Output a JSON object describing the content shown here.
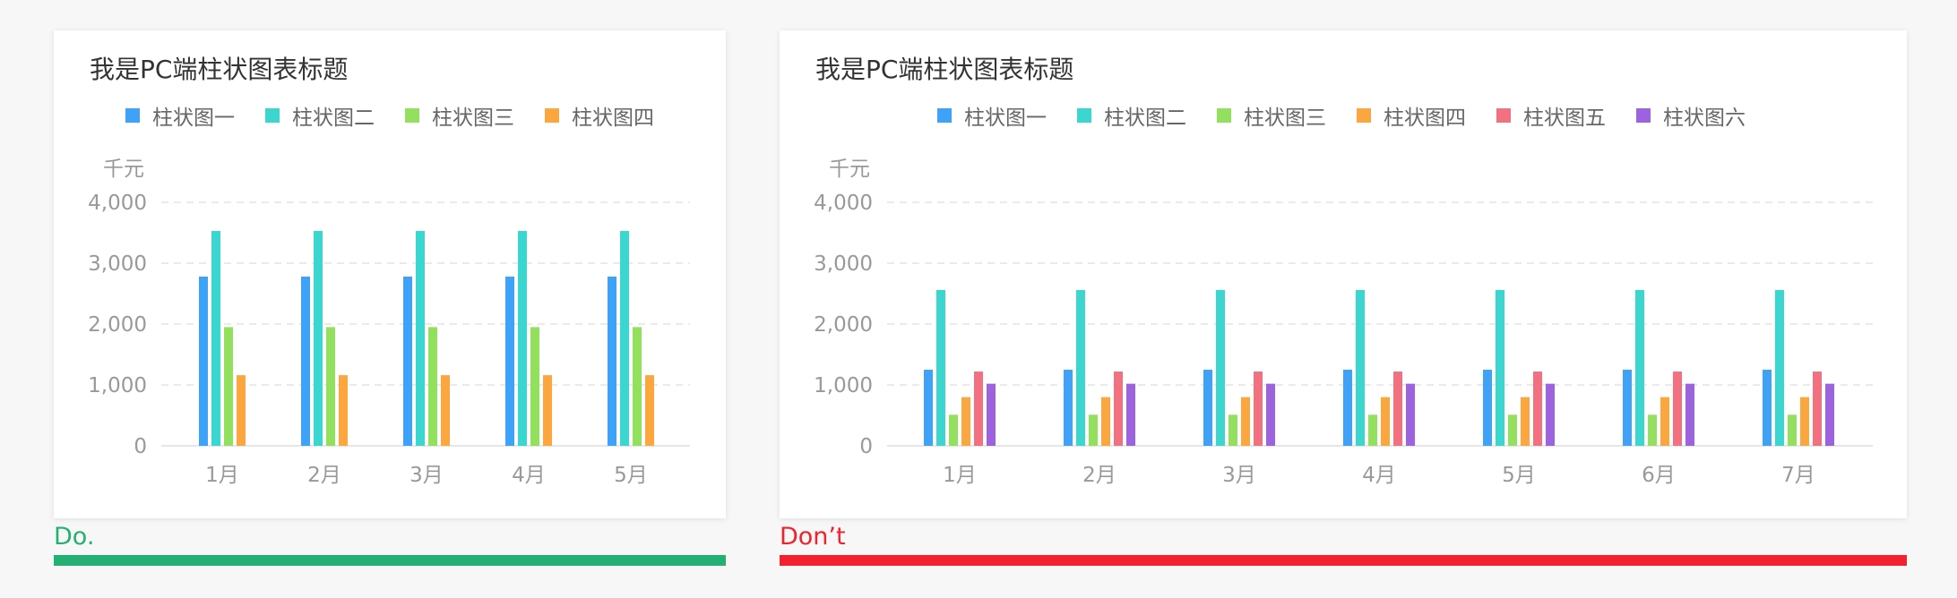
{
  "colors": [
    "#3ea2f8",
    "#3bd6cf",
    "#93e05e",
    "#fba63e",
    "#f2707f",
    "#9d62e0"
  ],
  "good_label": "Do.",
  "bad_label": "Don’t",
  "good_color": "#23b072",
  "bad_color": "#f3202d",
  "chart_data": [
    {
      "type": "bar",
      "title": "我是PC端柱状图表标题",
      "ylabel": "千元",
      "xlabel": "",
      "ylim": [
        0,
        4000
      ],
      "yticks": [
        "0",
        "1,000",
        "2,000",
        "3,000",
        "4,000"
      ],
      "grid": true,
      "legend_position": "top",
      "categories": [
        "1月",
        "2月",
        "3月",
        "4月",
        "5月"
      ],
      "series": [
        {
          "name": "柱状图一",
          "values": [
            2780,
            2780,
            2780,
            2780,
            2780
          ]
        },
        {
          "name": "柱状图二",
          "values": [
            3530,
            3530,
            3530,
            3530,
            3530
          ]
        },
        {
          "name": "柱状图三",
          "values": [
            1950,
            1950,
            1950,
            1950,
            1950
          ]
        },
        {
          "name": "柱状图四",
          "values": [
            1160,
            1160,
            1160,
            1160,
            1160
          ]
        }
      ]
    },
    {
      "type": "bar",
      "title": "我是PC端柱状图表标题",
      "ylabel": "千元",
      "xlabel": "",
      "ylim": [
        0,
        4000
      ],
      "yticks": [
        "0",
        "1,000",
        "2,000",
        "3,000",
        "4,000"
      ],
      "grid": true,
      "legend_position": "top",
      "categories": [
        "1月",
        "2月",
        "3月",
        "4月",
        "5月",
        "6月",
        "7月"
      ],
      "series": [
        {
          "name": "柱状图一",
          "values": [
            1250,
            1250,
            1250,
            1250,
            1250,
            1250,
            1250
          ]
        },
        {
          "name": "柱状图二",
          "values": [
            2560,
            2560,
            2560,
            2560,
            2560,
            2560,
            2560
          ]
        },
        {
          "name": "柱状图三",
          "values": [
            510,
            510,
            510,
            510,
            510,
            510,
            510
          ]
        },
        {
          "name": "柱状图四",
          "values": [
            800,
            800,
            800,
            800,
            800,
            800,
            800
          ]
        },
        {
          "name": "柱状图五",
          "values": [
            1220,
            1220,
            1220,
            1220,
            1220,
            1220,
            1220
          ]
        },
        {
          "name": "柱状图六",
          "values": [
            1020,
            1020,
            1020,
            1020,
            1020,
            1020,
            1020
          ]
        }
      ]
    }
  ]
}
